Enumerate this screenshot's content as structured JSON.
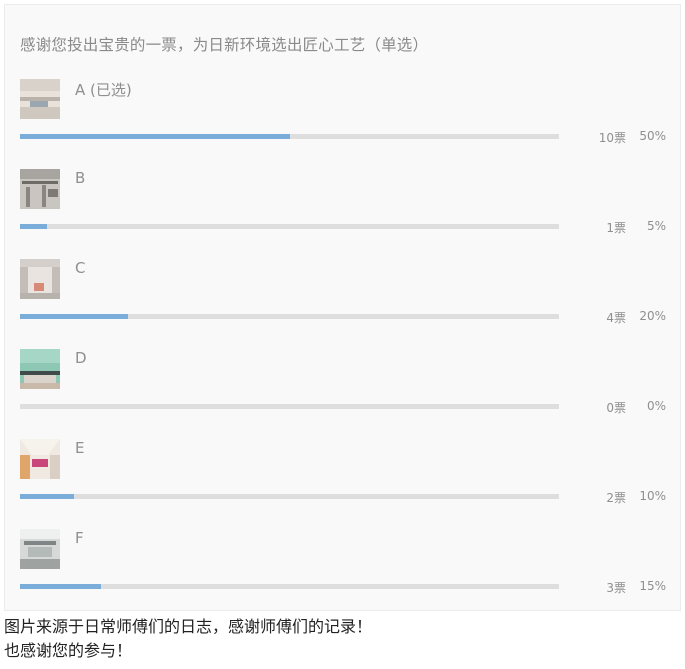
{
  "poll": {
    "question": "感谢您投出宝贵的一票，为日新环境选出匠心工艺（单选）",
    "options": [
      {
        "label": "A (已选)",
        "votes": "10票",
        "percent": "50%",
        "fraction": 0.5
      },
      {
        "label": "B",
        "votes": "1票",
        "percent": "5%",
        "fraction": 0.05
      },
      {
        "label": "C",
        "votes": "4票",
        "percent": "20%",
        "fraction": 0.2
      },
      {
        "label": "D",
        "votes": "0票",
        "percent": "0%",
        "fraction": 0.0
      },
      {
        "label": "E",
        "votes": "2票",
        "percent": "10%",
        "fraction": 0.1
      },
      {
        "label": "F",
        "votes": "3票",
        "percent": "15%",
        "fraction": 0.15
      }
    ]
  },
  "footer": {
    "line1": "图片来源于日常师傅们的日志，感谢师傅们的记录！",
    "line2": "也感谢您的参与！"
  },
  "colors": {
    "bar_fill": "#7aadda",
    "bar_track": "#dedede",
    "panel_bg": "#f9f9f9"
  }
}
